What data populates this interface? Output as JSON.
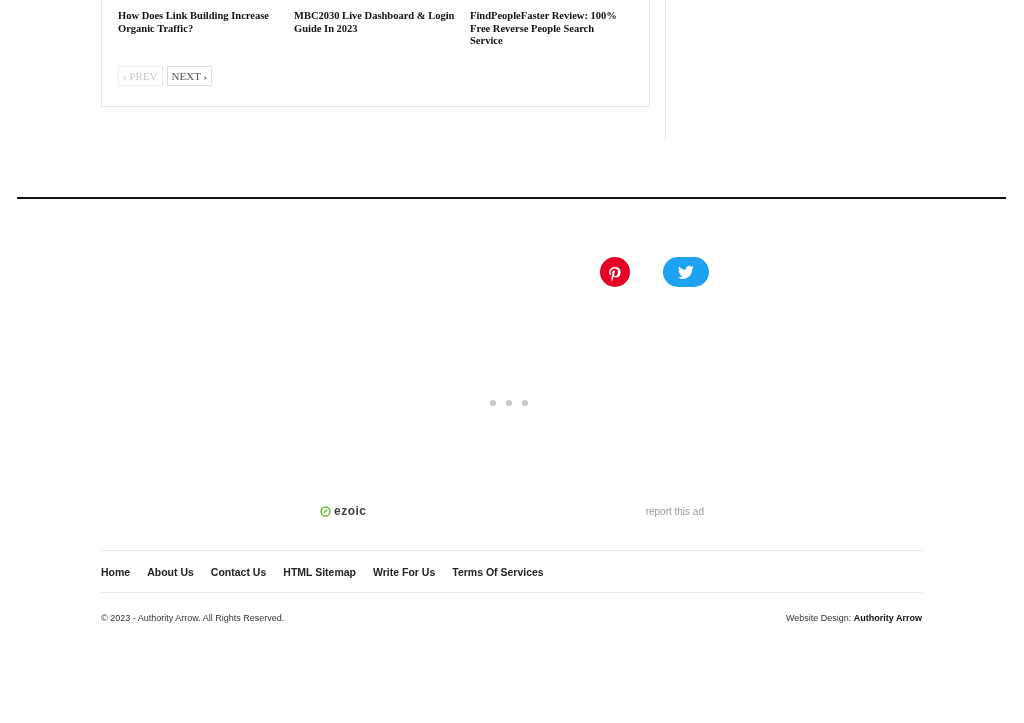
{
  "related_posts": [
    {
      "title": "How Does Link Building Increase Organic Traffic?"
    },
    {
      "title": "MBC2030 Live Dashboard & Login Guide In 2023"
    },
    {
      "title": "FindPeopleFaster Review: 100% Free Reverse People Search Service"
    }
  ],
  "pager": [
    {
      "label": "‹ PREV",
      "disabled": true
    },
    {
      "label": "NEXT ›",
      "disabled": false
    }
  ],
  "social": [
    {
      "kind": "pinterest"
    },
    {
      "kind": "twitter"
    }
  ],
  "ad": {
    "brand": "ezoic",
    "report": "report this ad"
  },
  "footer_nav": [
    {
      "label": "Home"
    },
    {
      "label": "About Us"
    },
    {
      "label": "Contact Us"
    },
    {
      "label": "HTML Sitemap"
    },
    {
      "label": "Write For Us"
    },
    {
      "label": "Terms Of Services"
    }
  ],
  "copyright": "© 2023 - Authority Arrow. All Rights Reserved.",
  "credit": "Website Design: **Authority Arrow**"
}
